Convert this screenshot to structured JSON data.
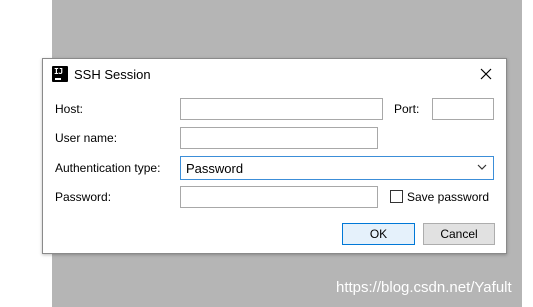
{
  "window": {
    "title": "SSH Session",
    "icon": "intellij-app-icon",
    "icon_text": "IJ"
  },
  "form": {
    "host_label": "Host:",
    "host_value": "",
    "port_label": "Port:",
    "port_value": "",
    "username_label": "User name:",
    "username_value": "",
    "auth_label": "Authentication type:",
    "auth_selected": "Password",
    "password_label": "Password:",
    "password_value": "",
    "save_password_label": "Save password",
    "save_password_checked": false
  },
  "buttons": {
    "ok": "OK",
    "cancel": "Cancel"
  },
  "watermark": "https://blog.csdn.net/Yafult",
  "colors": {
    "accent": "#0078d7",
    "select_border": "#3c8ed8",
    "backdrop": "#b5b5b5"
  }
}
